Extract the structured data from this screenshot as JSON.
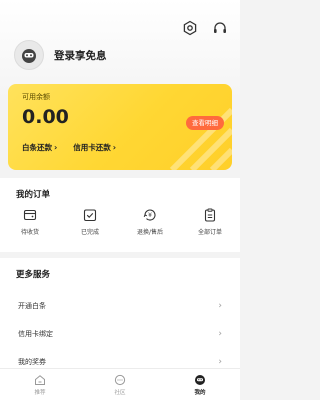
{
  "header": {
    "settings_icon": "hexagon-gear-icon",
    "service_icon": "headset-icon"
  },
  "profile": {
    "login_text": "登录享免息"
  },
  "balance_card": {
    "label": "可用余额",
    "amount": "0.00",
    "view_details_label": "查看明细",
    "links": [
      {
        "label": "白条还款"
      },
      {
        "label": "信用卡还款"
      }
    ],
    "accent_color": "#ff6a3d",
    "card_color": "#ffd733"
  },
  "orders": {
    "title": "我的订单",
    "items": [
      {
        "label": "待收货",
        "icon": "wallet-icon"
      },
      {
        "label": "已完成",
        "icon": "check-box-icon"
      },
      {
        "label": "退换/售后",
        "icon": "yuan-refund-icon"
      },
      {
        "label": "全部订单",
        "icon": "clipboard-icon"
      }
    ]
  },
  "services": {
    "title": "更多服务",
    "items": [
      {
        "label": "开通白条"
      },
      {
        "label": "信用卡绑定"
      },
      {
        "label": "我的奖券"
      }
    ]
  },
  "bottom_nav": {
    "items": [
      {
        "label": "推荐",
        "icon": "home-icon"
      },
      {
        "label": "社区",
        "icon": "chat-icon"
      },
      {
        "label": "我的",
        "icon": "profile-icon",
        "active": true
      }
    ]
  }
}
